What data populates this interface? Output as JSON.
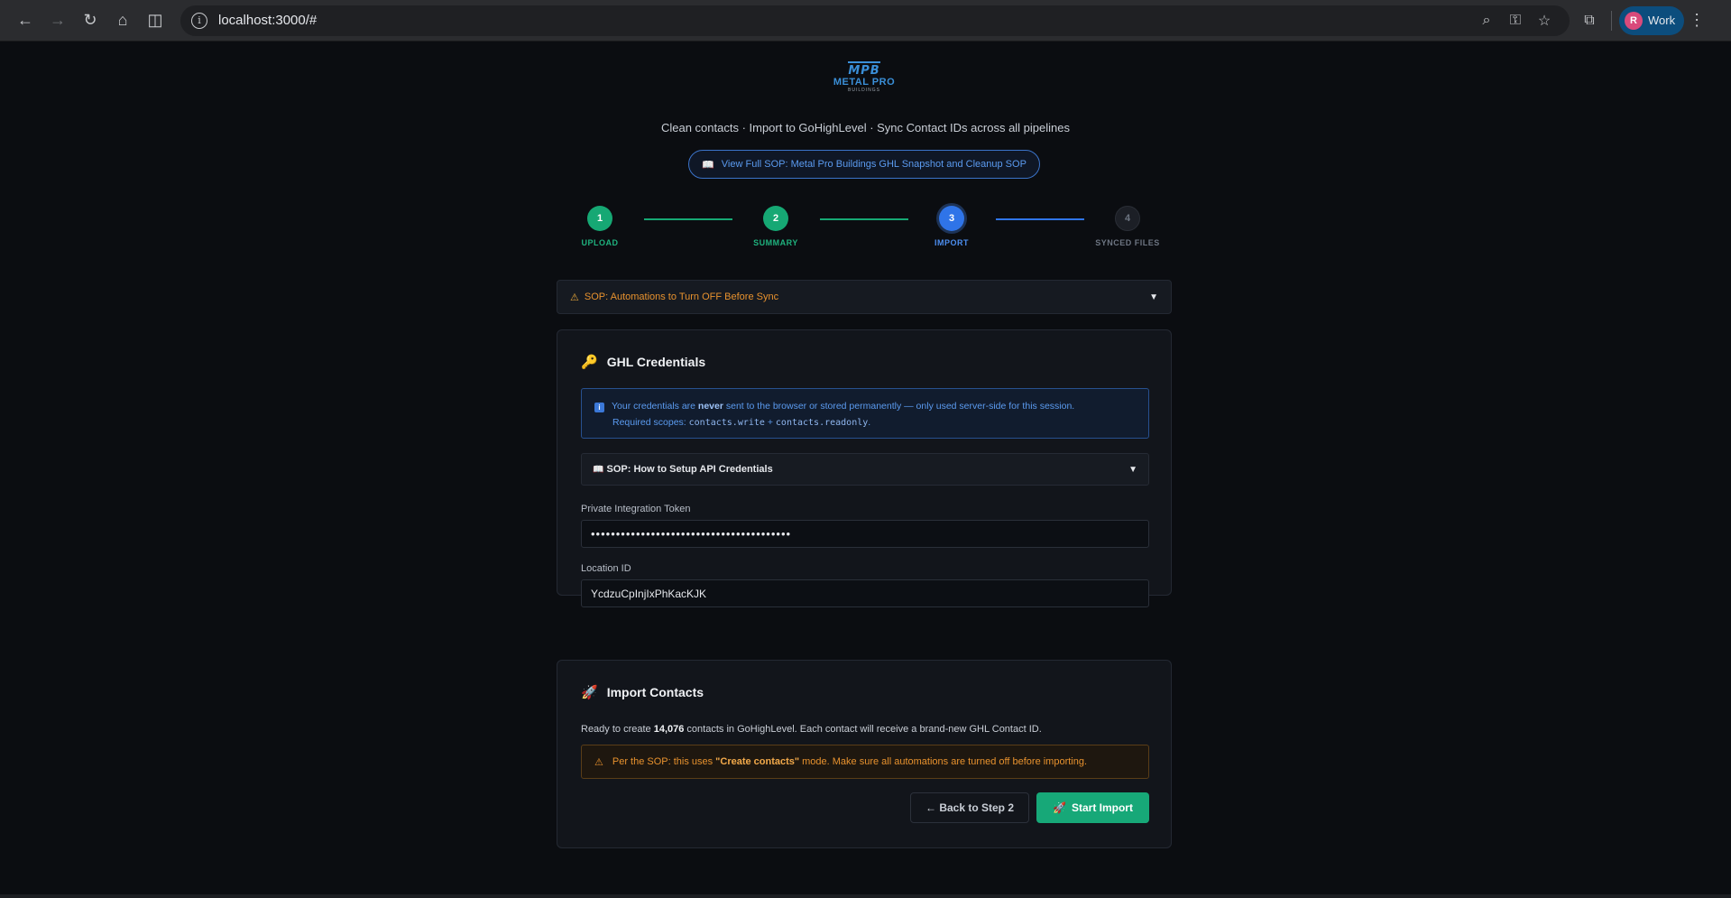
{
  "browser": {
    "url": "localhost:3000/#",
    "profile_initial": "R",
    "profile_name": "Work"
  },
  "header": {
    "logo_mark": "MPB",
    "logo_brand": "METAL PRO",
    "logo_sub": "BUILDINGS",
    "tagline": "Clean contacts · Import to GoHighLevel · Sync Contact IDs across all pipelines",
    "sop_link_label": "View Full SOP: Metal Pro Buildings GHL Snapshot and Cleanup SOP"
  },
  "stepper": {
    "steps": [
      {
        "number": "1",
        "label": "UPLOAD",
        "state": "done"
      },
      {
        "number": "2",
        "label": "SUMMARY",
        "state": "done"
      },
      {
        "number": "3",
        "label": "IMPORT",
        "state": "active"
      },
      {
        "number": "4",
        "label": "SYNCED FILES",
        "state": "pending"
      }
    ]
  },
  "automations_sop": {
    "label": "SOP: Automations to Turn OFF Before Sync",
    "color": "#e8922e"
  },
  "credentials": {
    "title": "GHL Credentials",
    "info_pre": "Your credentials are ",
    "info_bold": "never",
    "info_post": " sent to the browser or stored permanently — only used server-side for this session.",
    "scopes_pre": "Required scopes: ",
    "scope_1": "contacts.write",
    "scope_join": " + ",
    "scope_2": "contacts.readonly",
    "scopes_post": ".",
    "api_sop_label": "SOP: How to Setup API Credentials",
    "token_label": "Private Integration Token",
    "token_value": "••••••••••••••••••••••••••••••••••••••••",
    "location_label": "Location ID",
    "location_value": "YcdzuCpInjIxPhKacKJK"
  },
  "import": {
    "title": "Import Contacts",
    "ready_pre": "Ready to create ",
    "ready_count": "14,076",
    "ready_post": " contacts in GoHighLevel. Each contact will receive a brand-new GHL Contact ID.",
    "warn_pre": "Per the SOP: this uses ",
    "warn_bold": "\"Create contacts\"",
    "warn_post": " mode. Make sure all automations are turned off before importing.",
    "back_label": "← Back to Step 2",
    "start_label": "Start Import"
  }
}
